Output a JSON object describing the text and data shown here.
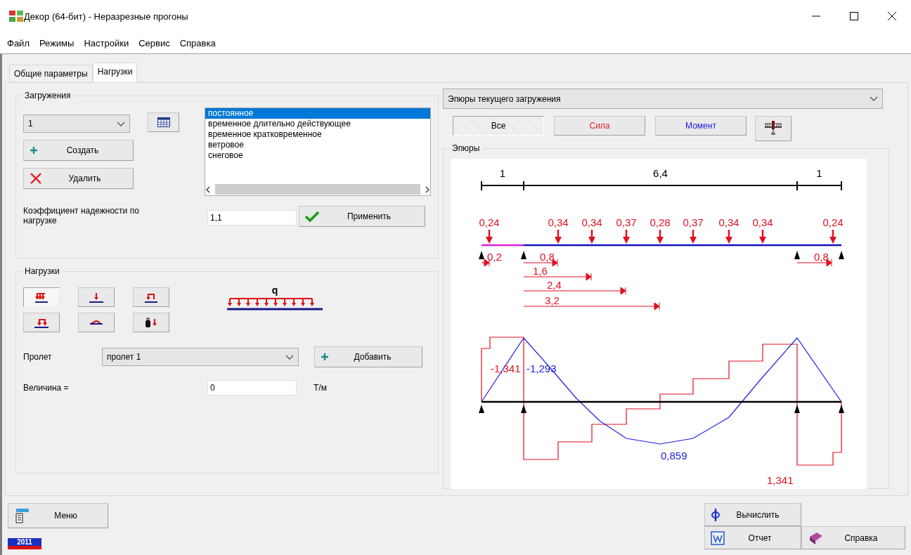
{
  "window": {
    "title": "Декор (64-бит) - Неразрезные прогоны"
  },
  "menu": [
    "Файл",
    "Режимы",
    "Настройки",
    "Сервис",
    "Справка"
  ],
  "tabs": [
    {
      "label": "Общие параметры",
      "selected": false
    },
    {
      "label": "Нагрузки",
      "selected": true
    }
  ],
  "loadings": {
    "title": "Загружения",
    "case": "1",
    "create": "Создать",
    "delete": "Удалить",
    "types": [
      {
        "label": "постоянное",
        "selected": true
      },
      {
        "label": "временное длительно действующее",
        "selected": false
      },
      {
        "label": "временное кратковременное",
        "selected": false
      },
      {
        "label": "ветровое",
        "selected": false
      },
      {
        "label": "снеговое",
        "selected": false
      }
    ],
    "factor_label": "Коэффициент надежности по нагрузке",
    "factor": "1,1",
    "apply": "Применить"
  },
  "loads": {
    "title": "Нагрузки",
    "types": [
      {
        "kind": "distributed",
        "selected": true
      },
      {
        "kind": "point",
        "selected": false
      },
      {
        "kind": "moment",
        "selected": false
      },
      {
        "kind": "partial",
        "selected": false
      },
      {
        "kind": "torque",
        "selected": false
      },
      {
        "kind": "weight",
        "selected": false
      }
    ],
    "preview_label": "q",
    "span_label": "Пролет",
    "span": "пролет 1",
    "add": "Добавить",
    "value_label": "Величина =",
    "value": "0",
    "unit": "Т/м"
  },
  "diagrams": {
    "mode": "Эпюры текущего загружения",
    "filters": [
      {
        "label": "Все",
        "kind": "all",
        "selected": true
      },
      {
        "label": "Сила",
        "kind": "force",
        "selected": false
      },
      {
        "label": "Момент",
        "kind": "moment",
        "selected": false
      }
    ],
    "title": "Эпюры",
    "spans": [
      "1",
      "6,4",
      "1"
    ],
    "loads": [
      "0,24",
      "0,34",
      "0,34",
      "0,37",
      "0,28",
      "0,37",
      "0,34",
      "0,34",
      "0,24"
    ],
    "distances": [
      "0,2",
      "0,8",
      "1,6",
      "2,4",
      "3,2",
      "0,8"
    ],
    "extremes": [
      {
        "label": "-1,341",
        "kind": "force"
      },
      {
        "label": "-1,293",
        "kind": "moment"
      },
      {
        "label": "0,859",
        "kind": "moment"
      },
      {
        "label": "1,341",
        "kind": "force"
      }
    ]
  },
  "bottom": {
    "menu": "Меню",
    "year": "2011",
    "calc": "Вычислить",
    "report": "Отчет",
    "help": "Справка"
  }
}
